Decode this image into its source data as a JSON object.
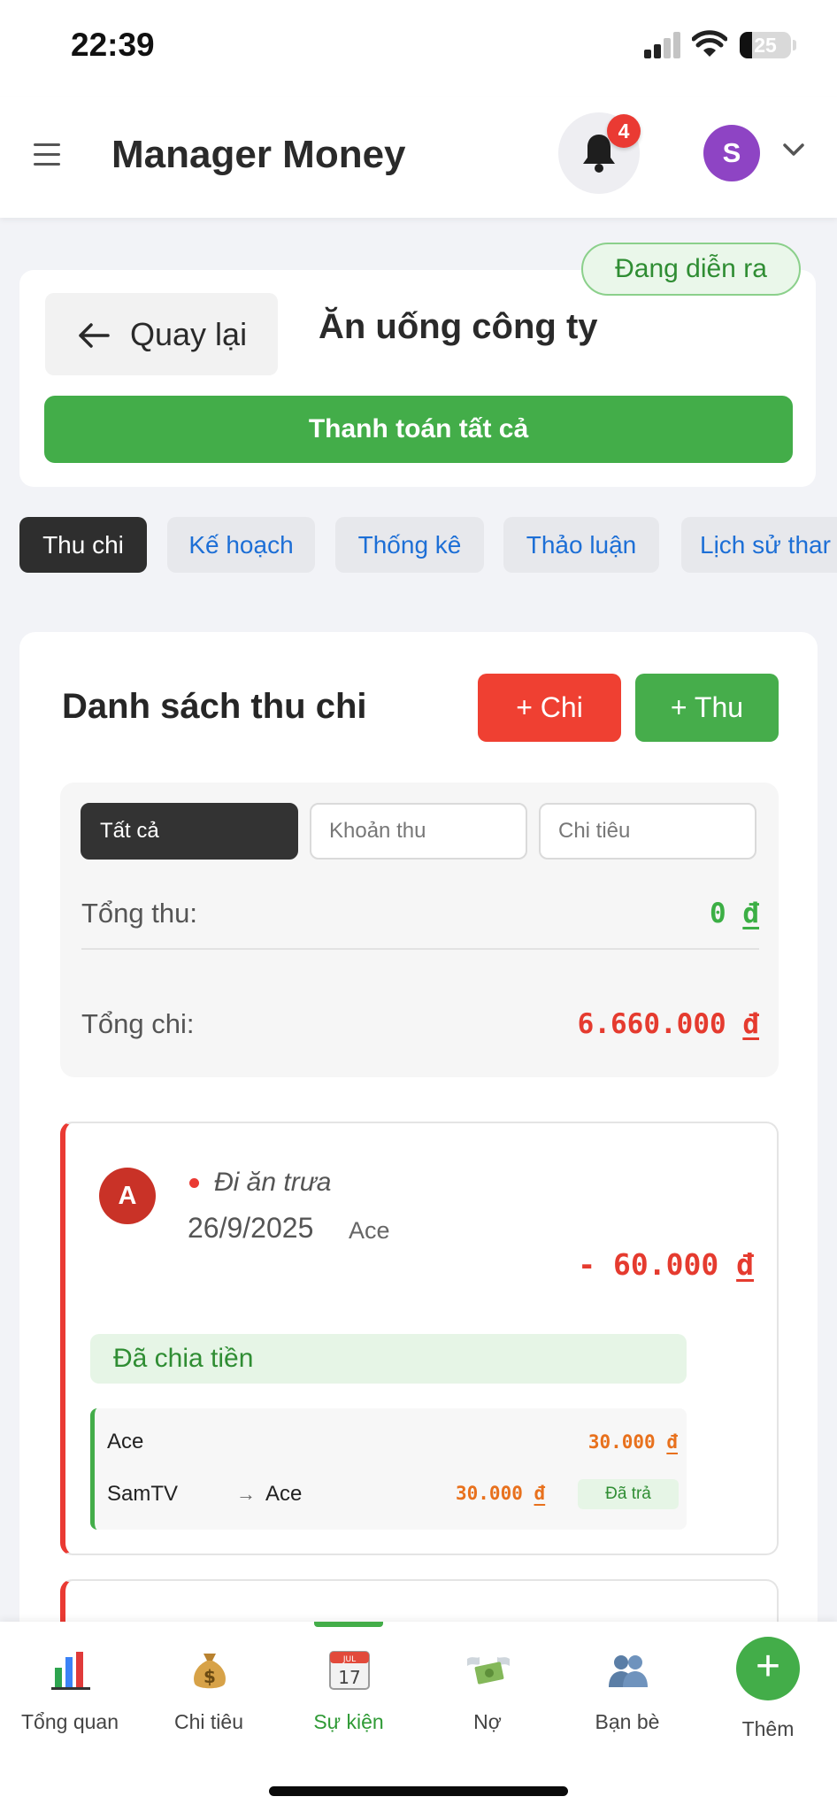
{
  "status_bar": {
    "time": "22:39",
    "battery": "25"
  },
  "header": {
    "menu_icon": "hamburger-icon",
    "title": "Manager Money",
    "notification_count": "4",
    "avatar_letter": "S"
  },
  "event": {
    "status": "Đang diễn ra",
    "back_label": "Quay lại",
    "title": "Ăn uống công ty",
    "pay_all_label": "Thanh toán tất cả"
  },
  "tabs": [
    {
      "label": "Thu chi",
      "active": true
    },
    {
      "label": "Kế hoạch",
      "active": false
    },
    {
      "label": "Thống kê",
      "active": false
    },
    {
      "label": "Thảo luận",
      "active": false
    },
    {
      "label": "Lịch sử thar",
      "active": false
    }
  ],
  "transactions_section": {
    "title": "Danh sách thu chi",
    "add_expense_label": "+ Chi",
    "add_income_label": "+ Thu",
    "filters": [
      {
        "label": "Tất cả",
        "active": true
      },
      {
        "label": "Khoản thu",
        "active": false
      },
      {
        "label": "Chi tiêu",
        "active": false
      }
    ],
    "total_income_label": "Tổng thu:",
    "total_income_value": "0",
    "total_expense_label": "Tổng chi:",
    "total_expense_value": "6.660.000",
    "currency": "đ"
  },
  "transactions": [
    {
      "avatar_letter": "A",
      "title": "Đi ăn trưa",
      "date": "26/9/2025",
      "payer": "Ace",
      "amount": "- 60.000",
      "split_status": "Đã chia tiền",
      "splits": [
        {
          "name": "Ace",
          "amount": "30.000"
        },
        {
          "name": "SamTV",
          "arrow": "→",
          "to": "Ace",
          "amount": "30.000",
          "status": "Đã trả"
        }
      ]
    }
  ],
  "bottom_nav": {
    "items": [
      {
        "label": "Tổng quan",
        "icon": "bar-chart-icon"
      },
      {
        "label": "Chi tiêu",
        "icon": "money-bag-icon"
      },
      {
        "label": "Sự kiện",
        "icon": "calendar-icon",
        "calendar_day": "17",
        "calendar_month": "JUL",
        "active": true
      },
      {
        "label": "Nợ",
        "icon": "flying-money-icon"
      },
      {
        "label": "Bạn bè",
        "icon": "people-icon"
      }
    ],
    "add_label": "Thêm",
    "add_symbol": "+"
  },
  "colors": {
    "primary_green": "#43ad49",
    "expense_red": "#ea3a33",
    "accent_orange": "#e8711d",
    "link_blue": "#1d6fd6"
  }
}
